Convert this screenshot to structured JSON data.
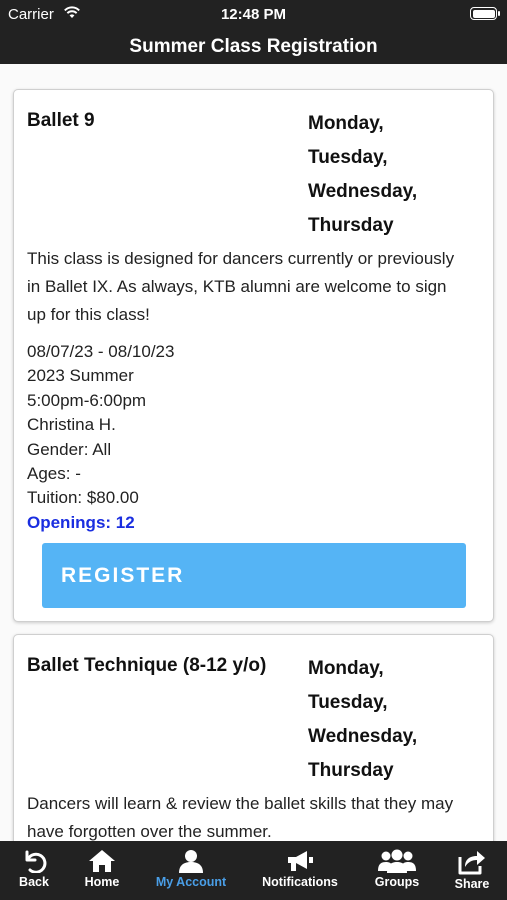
{
  "status_bar": {
    "carrier": "Carrier",
    "time": "12:48 PM"
  },
  "nav": {
    "title": "Summer Class Registration"
  },
  "classes": [
    {
      "name": "Ballet 9",
      "days": [
        "Monday,",
        "Tuesday,",
        "Wednesday,",
        "Thursday"
      ],
      "description": "This class is designed for dancers currently or previously in Ballet IX. As always, KTB alumni are welcome to sign up for this class!",
      "dates": "08/07/23 - 08/10/23",
      "session": "2023 Summer",
      "time": "5:00pm-6:00pm",
      "instructor": "Christina H.",
      "gender": "Gender: All",
      "ages": "Ages: -",
      "tuition": "Tuition: $80.00",
      "openings": "Openings: 12",
      "register_label": "REGISTER"
    },
    {
      "name": "Ballet Technique (8-12 y/o)",
      "days": [
        "Monday,",
        "Tuesday,",
        "Wednesday,",
        "Thursday"
      ],
      "description": "Dancers will learn & review the ballet skills that they may have forgotten over the summer."
    }
  ],
  "tabs": [
    {
      "label": "Back",
      "icon": "back-arrow-icon"
    },
    {
      "label": "Home",
      "icon": "home-icon"
    },
    {
      "label": "My Account",
      "icon": "account-icon",
      "active": true
    },
    {
      "label": "Notifications",
      "icon": "megaphone-icon"
    },
    {
      "label": "Groups",
      "icon": "groups-icon"
    },
    {
      "label": "Share",
      "icon": "share-icon"
    }
  ],
  "colors": {
    "bar_background": "#222222",
    "active_tab": "#4a9fe8",
    "register_button": "#55b4f5",
    "openings_text": "#1a2ee0"
  }
}
